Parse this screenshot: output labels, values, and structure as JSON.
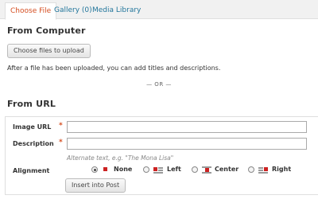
{
  "tabs": [
    {
      "label": "Choose File",
      "active": true
    },
    {
      "label": "Gallery (0)",
      "active": false
    },
    {
      "label": "Media Library",
      "active": false
    }
  ],
  "from_computer": {
    "heading": "From Computer",
    "choose_button": "Choose files to upload",
    "note": "After a file has been uploaded, you can add titles and descriptions."
  },
  "divider": "— OR —",
  "from_url": {
    "heading": "From URL",
    "image_url": {
      "label": "Image URL",
      "required_mark": "*",
      "value": ""
    },
    "description": {
      "label": "Description",
      "required_mark": "*",
      "value": ""
    },
    "alt_help": "Alternate text, e.g. \"The Mona Lisa\"",
    "alignment": {
      "label": "Alignment",
      "selected": "None",
      "options": [
        {
          "label": "None",
          "icon": "align-none-icon"
        },
        {
          "label": "Left",
          "icon": "align-left-icon"
        },
        {
          "label": "Center",
          "icon": "align-center-icon"
        },
        {
          "label": "Right",
          "icon": "align-right-icon"
        }
      ]
    },
    "insert_button": "Insert into Post"
  },
  "colors": {
    "active_tab": "#d54e21",
    "link": "#21759b",
    "required": "#d54e21"
  }
}
